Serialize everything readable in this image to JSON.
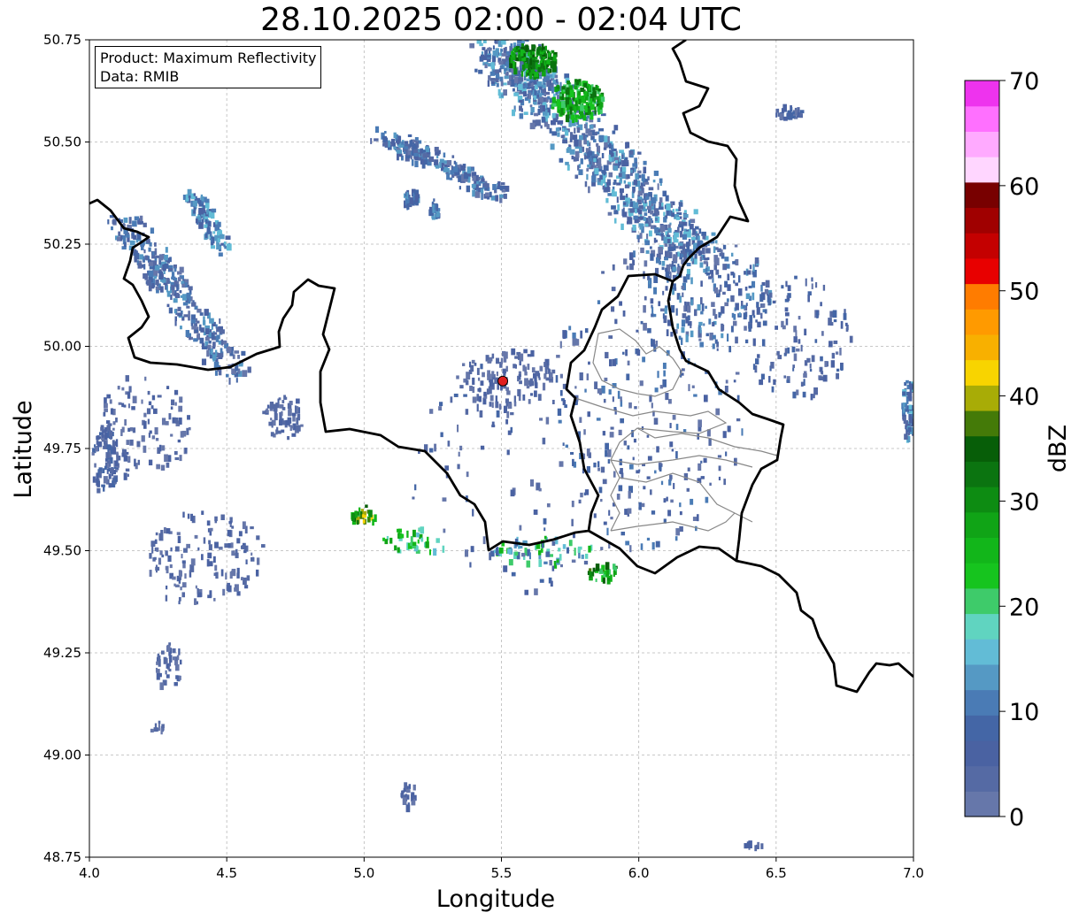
{
  "title": "28.10.2025 02:00 - 02:04 UTC",
  "info": {
    "product": "Product: Maximum Reflectivity",
    "source": "Data: RMIB"
  },
  "axes": {
    "xlabel": "Longitude",
    "ylabel": "Latitude",
    "xlim": [
      4.0,
      7.0
    ],
    "ylim": [
      48.75,
      50.75
    ],
    "xticks": [
      "4.0",
      "4.5",
      "5.0",
      "5.5",
      "6.0",
      "6.5",
      "7.0"
    ],
    "yticks": [
      "48.75",
      "49.00",
      "49.25",
      "49.50",
      "49.75",
      "50.00",
      "50.25",
      "50.50",
      "50.75"
    ],
    "grid": true
  },
  "radar_site": {
    "lon": 5.505,
    "lat": 49.915,
    "color": "#e02020"
  },
  "colorbar": {
    "label": "dBZ",
    "min": 0,
    "max": 70,
    "ticks": [
      "0",
      "10",
      "20",
      "30",
      "40",
      "50",
      "60",
      "70"
    ],
    "colors": [
      "#6677aa",
      "#556aa4",
      "#4a62a2",
      "#4466a6",
      "#4a7bb5",
      "#5599c4",
      "#62bcd6",
      "#60d4c0",
      "#3ecb6a",
      "#16c41e",
      "#12b61a",
      "#10a416",
      "#0d8c12",
      "#0b7410",
      "#075e08",
      "#447a08",
      "#a8ac06",
      "#f8d400",
      "#f8b000",
      "#ff9a00",
      "#ff7c00",
      "#e80000",
      "#c40000",
      "#a00000",
      "#780000",
      "#ffd6ff",
      "#ffaaff",
      "#ff70ff",
      "#ee33ee"
    ]
  }
}
